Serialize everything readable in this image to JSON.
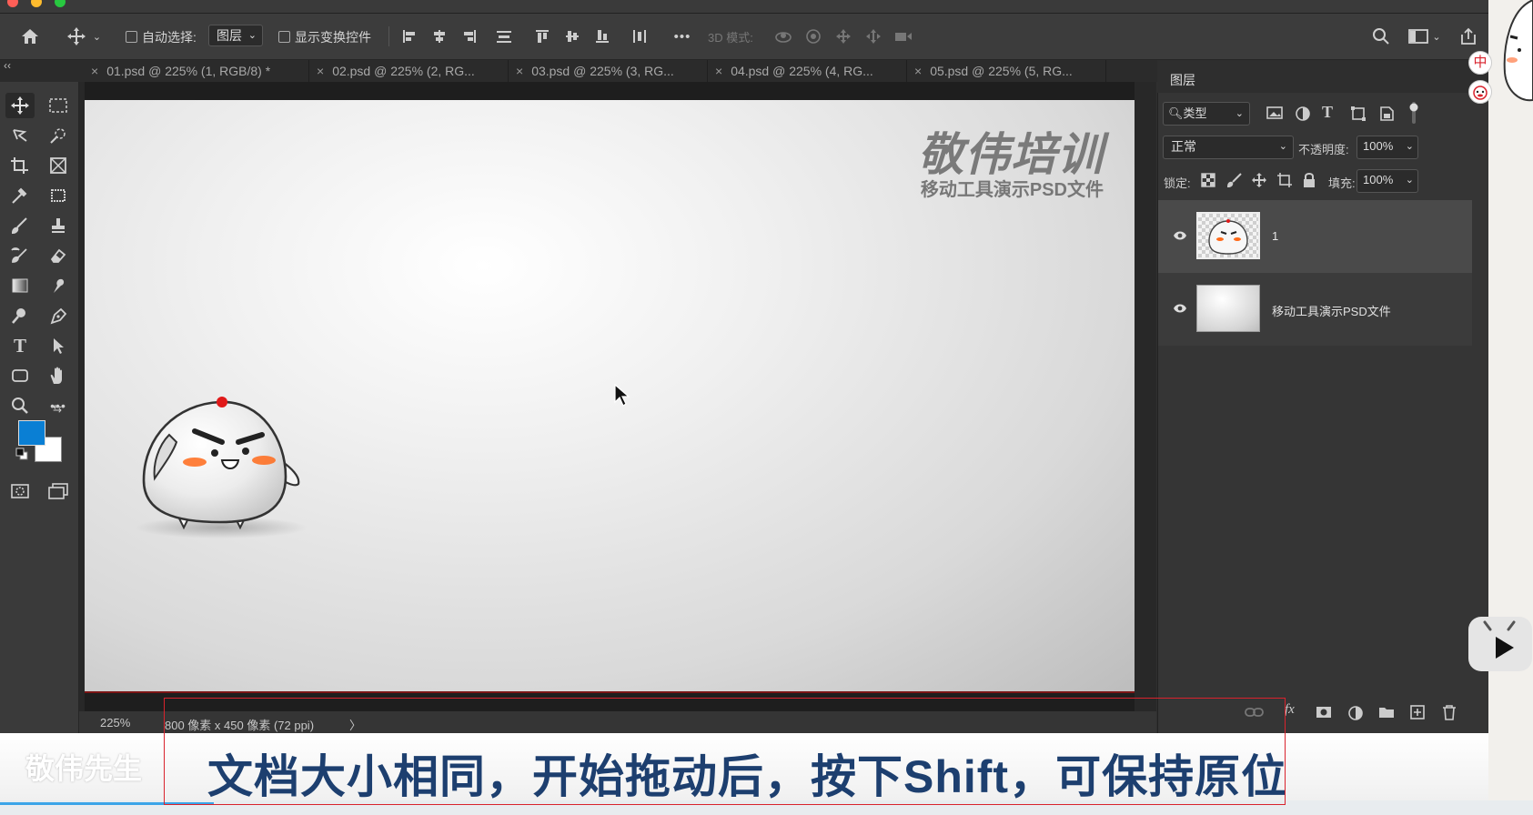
{
  "options_bar": {
    "auto_select_label": "自动选择:",
    "auto_select_target": "图层",
    "show_transform_label": "显示变换控件",
    "more_label": "•••",
    "mode_3d_label": "3D 模式:"
  },
  "tabs": [
    {
      "label": "01.psd @ 225% (1, RGB/8) *",
      "active": true
    },
    {
      "label": "02.psd @ 225% (2, RG...",
      "active": false
    },
    {
      "label": "03.psd @ 225% (3, RG...",
      "active": false
    },
    {
      "label": "04.psd @ 225% (4, RG...",
      "active": false
    },
    {
      "label": "05.psd @ 225% (5, RG...",
      "active": false
    }
  ],
  "canvas": {
    "brand_title": "敬伟培训",
    "brand_subtitle": "移动工具演示PSD文件"
  },
  "status": {
    "zoom": "225%",
    "doc_size": "800 像素 x 450 像素 (72 ppi)",
    "arrow": "〉"
  },
  "layers_panel": {
    "title": "图层",
    "filter_kind": "类型",
    "blend_mode": "正常",
    "opacity_label": "不透明度:",
    "opacity_value": "100%",
    "lock_label": "锁定:",
    "fill_label": "填充:",
    "fill_value": "100%",
    "layers": [
      {
        "name": "1",
        "visible": true,
        "selected": true
      },
      {
        "name": "移动工具演示PSD文件",
        "visible": true,
        "selected": false
      }
    ]
  },
  "colors": {
    "foreground": "#0a7fd4",
    "background": "#ffffff",
    "caption_text": "#1d3f6f",
    "highlight_box": "#d9232d"
  },
  "right_edge": {
    "ime_label": "中"
  },
  "caption": {
    "watermark": "敬伟先生",
    "text": "文档大小相同，开始拖动后，按下Shift，可保持原位"
  }
}
